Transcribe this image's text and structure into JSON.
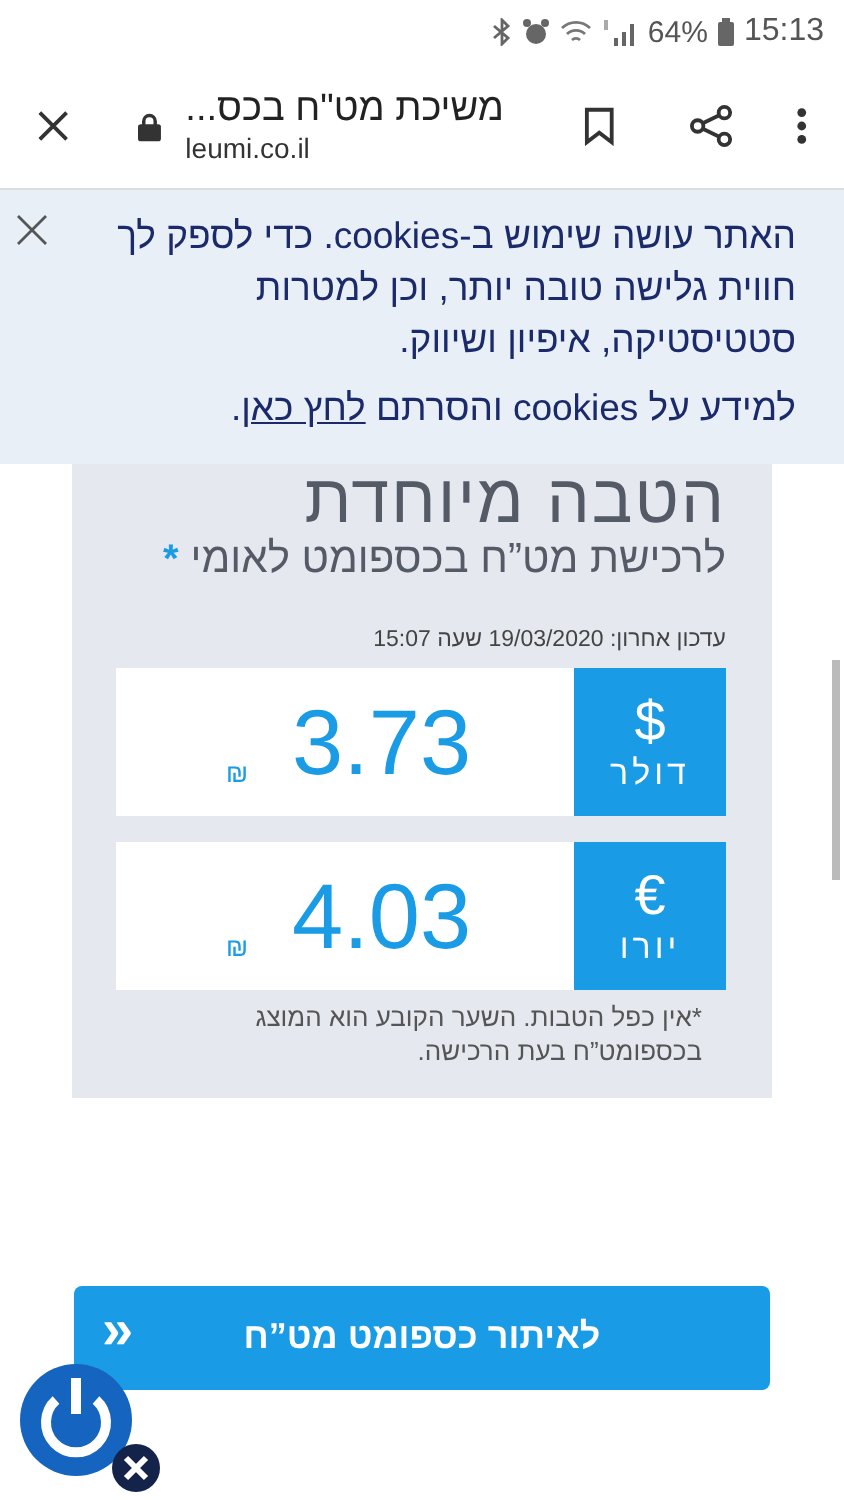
{
  "status_bar": {
    "battery": "64%",
    "time": "15:13"
  },
  "browser": {
    "page_title": "משיכת מט\"ח בכס...",
    "url": "leumi.co.il"
  },
  "cookie_banner": {
    "text": "האתר עושה שימוש ב-cookies. כדי לספק לך חווית גלישה טובה יותר, וכן למטרות סטטיסטיקה, איפיון ושיווק.",
    "more_prefix": "למידע על cookies והסרתם ",
    "link": "לחץ כאן",
    "more_suffix": "."
  },
  "offer": {
    "title": "הטבה מיוחדת",
    "subtitle": "לרכישת מט”ח בכספומט לאומי",
    "asterisk": "*",
    "updated": "עדכון אחרון: 19/03/2020  שעה 15:07",
    "rates": [
      {
        "symbol": "$",
        "name": "דולר",
        "value": "3.73",
        "currency": "₪"
      },
      {
        "symbol": "€",
        "name": "יורו",
        "value": "4.03",
        "currency": "₪"
      }
    ],
    "note": "*אין כפל הטבות. השער הקובע הוא המוצג בכספומט”ח בעת הרכישה."
  },
  "locate_button": {
    "label": "לאיתור כספומט מט”ח",
    "arrows": "«"
  }
}
